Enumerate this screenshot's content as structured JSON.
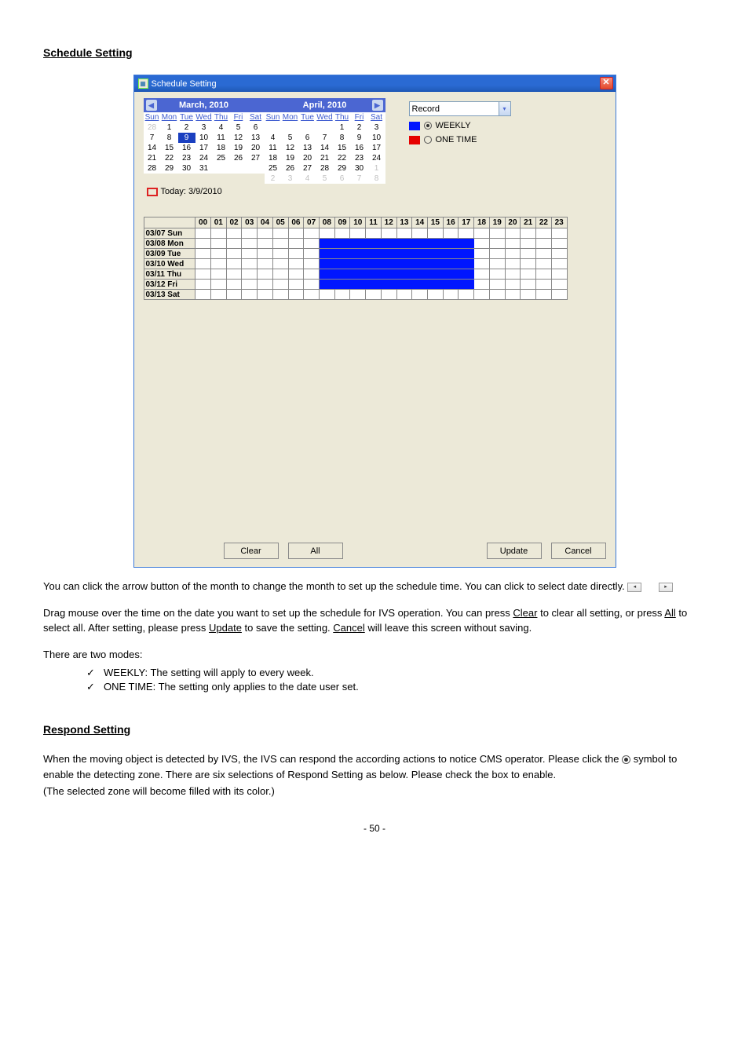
{
  "page": {
    "heading1": "Schedule Setting",
    "heading2": "Respond Setting",
    "body1": "You can click the arrow button of the month to change the month to set up the schedule time. You can click to select date directly.",
    "body2_a": "Drag mouse over the time on the date you want to set up the schedule for IVS operation. You can press ",
    "body2_clear": "Clear",
    "body2_b": " to clear all setting, or press ",
    "body2_all": "All",
    "body2_c": " to select all. After setting, please press ",
    "body2_update": "Update",
    "body2_d": " to save the setting. ",
    "body2_cancel": "Cancel",
    "body2_e": " will leave this screen without saving.",
    "list_intro": "There are two modes:",
    "check1": "WEEKLY: The setting will apply to every week.",
    "check2": "ONE TIME: The setting only applies to the date user set.",
    "body3_a": "When the moving object is detected by IVS, the IVS can respond the according actions to notice CMS operator. Please click the ",
    "body3_radio": "",
    "body3_b": " symbol to enable the detecting zone. There are six selections of Respond Setting as below. Please check the box to enable.",
    "color_note": "(The selected zone will become filled with its color.)",
    "pagenum": "- 50 -"
  },
  "window": {
    "title": "Schedule Setting",
    "combo": "Record",
    "weekly": "WEEKLY",
    "onetime": "ONE TIME",
    "today": "Today: 3/9/2010",
    "clear": "Clear",
    "all": "All",
    "update": "Update",
    "cancel": "Cancel",
    "month1": {
      "title": "March, 2010",
      "dow": [
        "Sun",
        "Mon",
        "Tue",
        "Wed",
        "Thu",
        "Fri",
        "Sat"
      ],
      "prev": [
        28
      ],
      "days": [
        1,
        2,
        3,
        4,
        5,
        6,
        7,
        8,
        9,
        10,
        11,
        12,
        13,
        14,
        15,
        16,
        17,
        18,
        19,
        20,
        21,
        22,
        23,
        24,
        25,
        26,
        27,
        28,
        29,
        30,
        31
      ],
      "next": [],
      "selected": 9
    },
    "month2": {
      "title": "April, 2010",
      "dow": [
        "Sun",
        "Mon",
        "Tue",
        "Wed",
        "Thu",
        "Fri",
        "Sat"
      ],
      "pre_blanks": 4,
      "days": [
        1,
        2,
        3,
        4,
        5,
        6,
        7,
        8,
        9,
        10,
        11,
        12,
        13,
        14,
        15,
        16,
        17,
        18,
        19,
        20,
        21,
        22,
        23,
        24,
        25,
        26,
        27,
        28,
        29,
        30
      ],
      "next": [
        1,
        2,
        3,
        4,
        5,
        6,
        7,
        8
      ]
    },
    "hours": [
      "00",
      "01",
      "02",
      "03",
      "04",
      "05",
      "06",
      "07",
      "08",
      "09",
      "10",
      "11",
      "12",
      "13",
      "14",
      "15",
      "16",
      "17",
      "18",
      "19",
      "20",
      "21",
      "22",
      "23"
    ],
    "rows": [
      {
        "label": "03/07 Sun",
        "fill": []
      },
      {
        "label": "03/08 Mon",
        "fill": [
          8,
          9,
          10,
          11,
          12,
          13,
          14,
          15,
          16,
          17
        ]
      },
      {
        "label": "03/09 Tue",
        "fill": [
          8,
          9,
          10,
          11,
          12,
          13,
          14,
          15,
          16,
          17
        ]
      },
      {
        "label": "03/10 Wed",
        "fill": [
          8,
          9,
          10,
          11,
          12,
          13,
          14,
          15,
          16,
          17
        ]
      },
      {
        "label": "03/11 Thu",
        "fill": [
          8,
          9,
          10,
          11,
          12,
          13,
          14,
          15,
          16,
          17
        ]
      },
      {
        "label": "03/12 Fri",
        "fill": [
          8,
          9,
          10,
          11,
          12,
          13,
          14,
          15,
          16,
          17
        ]
      },
      {
        "label": "03/13 Sat",
        "fill": []
      }
    ]
  }
}
